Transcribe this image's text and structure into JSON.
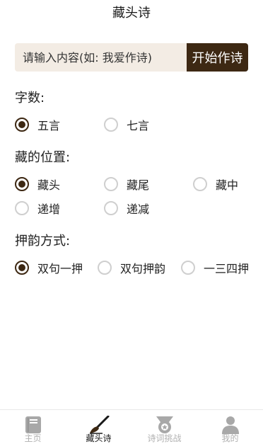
{
  "header": {
    "title": "藏头诗"
  },
  "input": {
    "placeholder": "请输入内容(如: 我爱作诗)",
    "value": ""
  },
  "start_button": {
    "label": "开始作诗"
  },
  "sections": {
    "word_count": {
      "label": "字数:",
      "options": [
        {
          "label": "五言",
          "selected": true
        },
        {
          "label": "七言",
          "selected": false
        }
      ]
    },
    "position": {
      "label": "藏的位置:",
      "options": [
        {
          "label": "藏头",
          "selected": true
        },
        {
          "label": "藏尾",
          "selected": false
        },
        {
          "label": "藏中",
          "selected": false
        },
        {
          "label": "递增",
          "selected": false
        },
        {
          "label": "递减",
          "selected": false
        }
      ]
    },
    "rhyme": {
      "label": "押韵方式:",
      "options": [
        {
          "label": "双句一押",
          "selected": true
        },
        {
          "label": "双句押韵",
          "selected": false
        },
        {
          "label": "一三四押",
          "selected": false
        }
      ]
    }
  },
  "tabbar": {
    "items": [
      {
        "label": "主页",
        "icon": "book-icon",
        "active": false
      },
      {
        "label": "藏头诗",
        "icon": "brush-icon",
        "active": true
      },
      {
        "label": "诗词挑战",
        "icon": "medal-icon",
        "active": false
      },
      {
        "label": "我的",
        "icon": "person-icon",
        "active": false
      }
    ]
  },
  "colors": {
    "accent": "#3d2813",
    "input_bg": "#f3ece4",
    "inactive": "#b0b0b0"
  }
}
